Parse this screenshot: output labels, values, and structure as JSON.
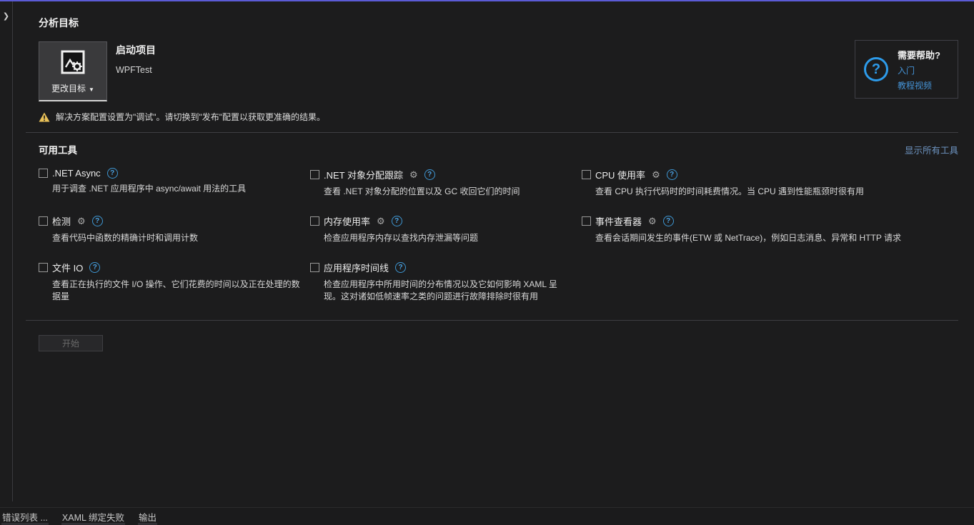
{
  "icons": {
    "chevron": "❯",
    "dropdown": "▼",
    "help": "?",
    "gear": "⚙"
  },
  "colors": {
    "top_accent": "#5b5bd6",
    "link_blue": "#4593d6",
    "help_ring_blue": "#2d9bea",
    "warning_yellow": "#e9c158",
    "background": "#1c1c1d"
  },
  "page": {
    "title": "分析目标"
  },
  "target": {
    "change_button_label": "更改目标",
    "type_label": "启动项目",
    "project_name": "WPFTest"
  },
  "warning": {
    "text": "解决方案配置设置为\"调试\"。请切换到\"发布\"配置以获取更准确的结果。"
  },
  "help": {
    "title": "需要帮助?",
    "link_getting_started": "入门",
    "link_tutorial_videos": "教程视频"
  },
  "tools": {
    "header": "可用工具",
    "show_all_label": "显示所有工具",
    "items": [
      {
        "label": ".NET Async",
        "desc": "用于调查 .NET 应用程序中 async/await 用法的工具",
        "checked": false,
        "has_settings": false
      },
      {
        "label": ".NET 对象分配跟踪",
        "desc": "查看 .NET 对象分配的位置以及 GC 收回它们的时间",
        "checked": false,
        "has_settings": true
      },
      {
        "label": "CPU 使用率",
        "desc": "查看 CPU 执行代码时的时间耗费情况。当 CPU 遇到性能瓶颈时很有用",
        "checked": false,
        "has_settings": true
      },
      {
        "label": "检测",
        "desc": "查看代码中函数的精确计时和调用计数",
        "checked": false,
        "has_settings": true
      },
      {
        "label": "内存使用率",
        "desc": "检查应用程序内存以查找内存泄漏等问题",
        "checked": false,
        "has_settings": true
      },
      {
        "label": "事件查看器",
        "desc": "查看会话期间发生的事件(ETW 或 NetTrace)，例如日志消息、异常和 HTTP 请求",
        "checked": false,
        "has_settings": true
      },
      {
        "label": "文件 IO",
        "desc": "查看正在执行的文件 I/O 操作、它们花费的时间以及正在处理的数据量",
        "checked": false,
        "has_settings": false
      },
      {
        "label": "应用程序时间线",
        "desc": "检查应用程序中所用时间的分布情况以及它如何影响 XAML 呈现。这对诸如低帧速率之类的问题进行故障排除时很有用",
        "checked": false,
        "has_settings": false
      }
    ]
  },
  "start_button_label": "开始",
  "bottom_tabs": [
    "错误列表 ...",
    "XAML 绑定失败",
    "输出"
  ]
}
